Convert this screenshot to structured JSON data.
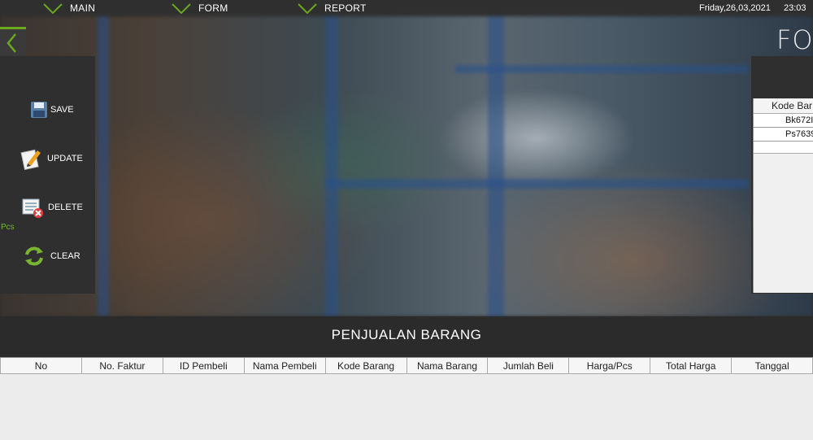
{
  "nav": {
    "items": [
      {
        "label": "MAIN"
      },
      {
        "label": "FORM"
      },
      {
        "label": "REPORT"
      }
    ]
  },
  "datetime": {
    "date": "Friday,26,03,2021",
    "time": "23:03"
  },
  "form_title": "FO",
  "side": {
    "save": "SAVE",
    "update": "UPDATE",
    "delete": "DELETE",
    "clear": "CLEAR",
    "pcs": "Pcs"
  },
  "mini_table": {
    "header": "Kode Bar",
    "rows": [
      "Bk672I",
      "Ps7639"
    ]
  },
  "section_title": "PENJUALAN BARANG",
  "table": {
    "columns": [
      "No",
      "No. Faktur",
      "ID Pembeli",
      "Nama Pembeli",
      "Kode Barang",
      "Nama Barang",
      "Jumlah Beli",
      "Harga/Pcs",
      "Total Harga",
      "Tanggal"
    ]
  },
  "colors": {
    "accent": "#6aa81e",
    "panel": "#2f2f2f"
  }
}
